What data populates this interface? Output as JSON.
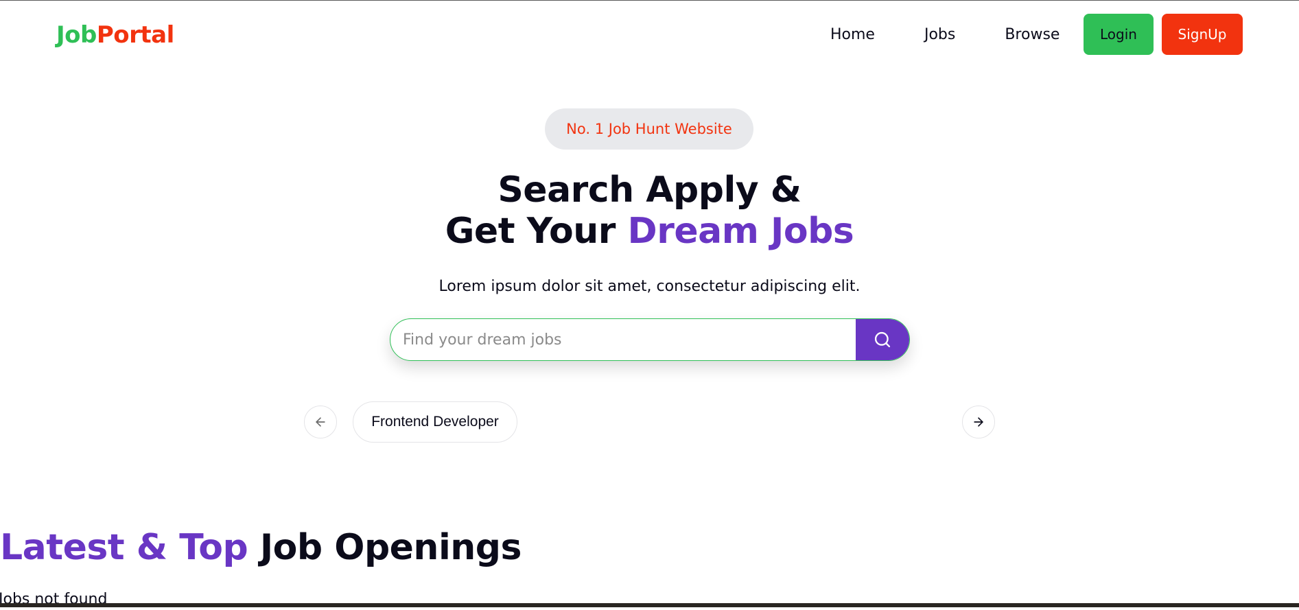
{
  "brand": {
    "logo_part1": "Job",
    "logo_part2": "Portal",
    "colors": {
      "green": "#2fbf56",
      "red": "#f2330f",
      "purple": "#6936c4"
    }
  },
  "nav": {
    "links": [
      "Home",
      "Jobs",
      "Browse"
    ],
    "login_label": "Login",
    "signup_label": "SignUp"
  },
  "hero": {
    "badge": "No. 1 Job Hunt Website",
    "title_line1": "Search Apply &",
    "title_line2_plain": "Get Your ",
    "title_line2_highlight": "Dream Jobs",
    "subtitle": "Lorem ipsum dolor sit amet, consectetur adipiscing elit."
  },
  "search": {
    "placeholder": "Find your dream jobs",
    "value": "",
    "icon": "search-icon"
  },
  "carousel": {
    "prev_icon": "arrow-left-icon",
    "next_icon": "arrow-right-icon",
    "categories": [
      "Frontend Developer"
    ]
  },
  "latest_jobs": {
    "title_highlight": "Latest & Top",
    "title_plain": " Job Openings",
    "empty_message": "Jobs not found"
  }
}
